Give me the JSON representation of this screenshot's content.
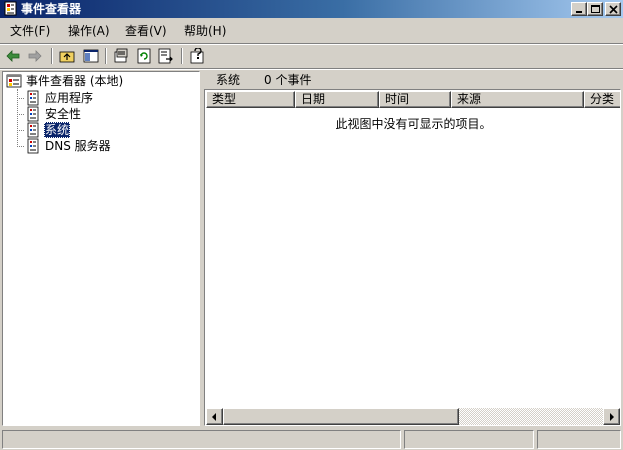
{
  "window": {
    "title": "事件查看器"
  },
  "menu": [
    {
      "label": "文件(F)"
    },
    {
      "label": "操作(A)"
    },
    {
      "label": "查看(V)"
    },
    {
      "label": "帮助(H)"
    }
  ],
  "tree": {
    "root": {
      "label": "事件查看器 (本地)",
      "icon": "event-viewer-icon"
    },
    "items": [
      {
        "label": "应用程序",
        "icon": "log-icon",
        "selected": false
      },
      {
        "label": "安全性",
        "icon": "log-icon",
        "selected": false
      },
      {
        "label": "系统",
        "icon": "log-icon",
        "selected": true
      },
      {
        "label": "DNS 服务器",
        "icon": "log-icon",
        "selected": false
      }
    ]
  },
  "right_pane": {
    "title": "系统",
    "count": "0 个事件",
    "columns": [
      "类型",
      "日期",
      "时间",
      "来源",
      "分类"
    ],
    "empty_message": "此视图中没有可显示的项目。"
  },
  "colors": {
    "title_bar": "#0a246a",
    "selection": "#0a246a",
    "face": "#d4d0c8"
  }
}
